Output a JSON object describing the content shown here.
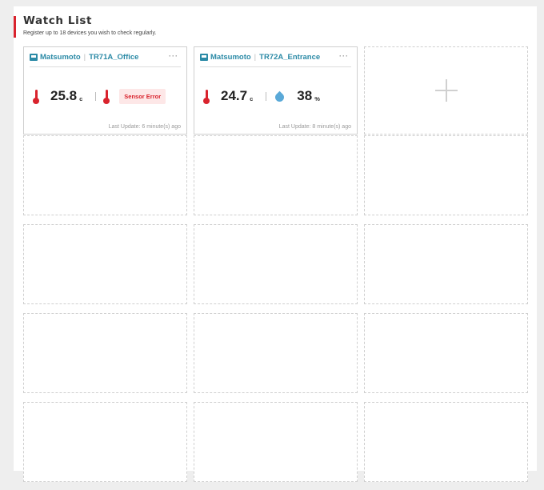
{
  "header": {
    "title": "Watch List",
    "subtitle": "Register up to 18 devices you wish to check regularly."
  },
  "cards": [
    {
      "group": "Matsumoto",
      "device": "TR71A_Office",
      "more_label": "···",
      "temp1_value": "25.8",
      "temp1_unit": "c",
      "status": "Sensor Error",
      "last_update": "Last Update: 6 minute(s) ago"
    },
    {
      "group": "Matsumoto",
      "device": "TR72A_Entrance",
      "more_label": "···",
      "temp_value": "24.7",
      "temp_unit": "c",
      "humidity_value": "38",
      "humidity_unit": "%",
      "last_update": "Last Update: 8 minute(s) ago"
    }
  ],
  "colors": {
    "accent_red": "#d9232d",
    "link_teal": "#2b8aa6",
    "water_blue": "#5aa9d8"
  },
  "icons": {
    "device": "device-icon",
    "thermometer": "thermometer-icon",
    "humidity": "water-drop-icon",
    "add": "plus-icon"
  }
}
